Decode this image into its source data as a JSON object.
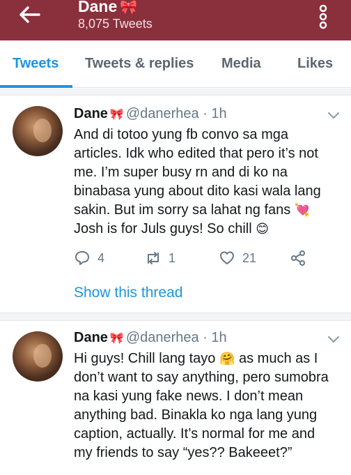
{
  "header": {
    "name": "Dane",
    "name_emoji": "🎀",
    "tweet_count": "8,075 Tweets",
    "bg_color": "#8a2f3c"
  },
  "tabs": [
    {
      "label": "Tweets",
      "active": true
    },
    {
      "label": "Tweets & replies",
      "active": false
    },
    {
      "label": "Media",
      "active": false
    },
    {
      "label": "Likes",
      "active": false
    }
  ],
  "tweets": [
    {
      "name": "Dane",
      "emoji": "🎀",
      "handle": "@danerhea · 1h",
      "lines": [
        "And di totoo yung fb convo sa mga",
        "articles. Idk who edited that pero it’s not",
        "me. I’m super busy rn and di ko na",
        "binabasa yung about dito kasi wala lang",
        "sakin. But im sorry sa lahat ng fans"
      ],
      "line6": "Josh is for Juls guys! So chill",
      "heart_emoji": "💘",
      "smile_emoji": "😊",
      "replies": "4",
      "retweets": "1",
      "likes": "21",
      "show_thread": "Show this thread"
    },
    {
      "name": "Dane",
      "emoji": "🎀",
      "handle": "@danerhea · 1h",
      "line1a": "Hi guys! Chill lang tayo",
      "line1_emoji": "🤗",
      "line1b": "as much as I",
      "lines": [
        "don’t want to say anything, pero sumobra",
        "na kasi yung fake news. I don’t mean",
        "anything bad. Binakla ko nga lang yung",
        "caption, actually. It’s normal for me and",
        "my friends to say “yes?? Bakeeet?”"
      ]
    }
  ],
  "icons": {
    "back": "arrow-left-icon",
    "more": "more-vertical-icon",
    "reply": "reply-icon",
    "retweet": "retweet-icon",
    "like": "heart-icon",
    "share": "share-icon",
    "caret": "chevron-down-icon"
  },
  "colors": {
    "accent": "#1c95e0",
    "muted": "#657786"
  }
}
